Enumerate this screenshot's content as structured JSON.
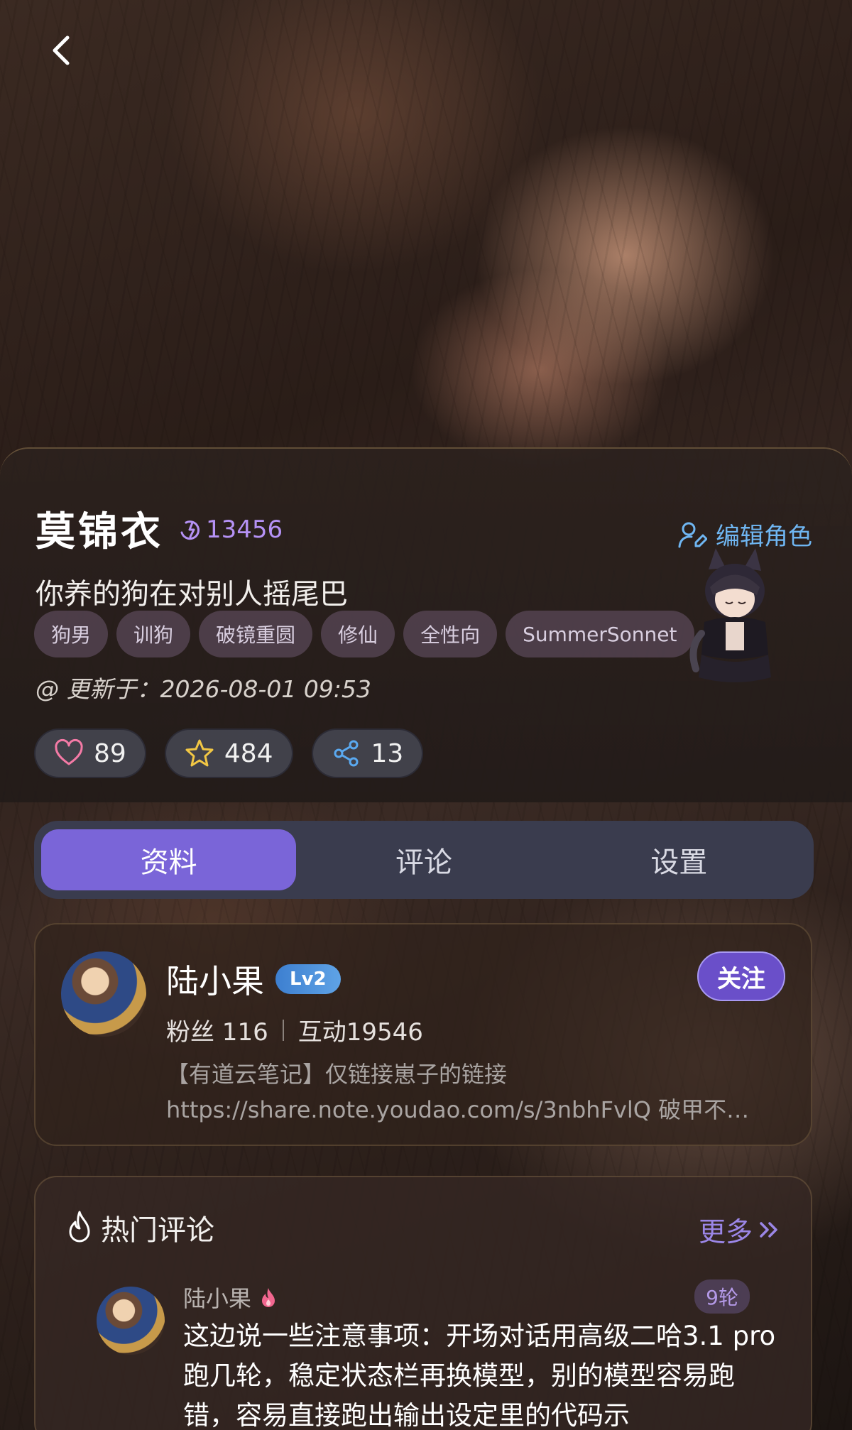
{
  "header": {
    "back_icon": "chevron-left-icon"
  },
  "character": {
    "name": "莫锦衣",
    "heat": "13456",
    "edit_label": "编辑角色",
    "tagline": "你养的狗在对别人摇尾巴",
    "tags": [
      "狗男",
      "训狗",
      "破镜重圆",
      "修仙",
      "全性向",
      "SummerSonnet"
    ],
    "updated": "@ 更新于：2026-08-01 09:53",
    "stats": {
      "likes": "89",
      "favorites": "484",
      "shares": "13"
    }
  },
  "tabs": [
    {
      "label": "资料",
      "active": true
    },
    {
      "label": "评论",
      "active": false
    },
    {
      "label": "设置",
      "active": false
    }
  ],
  "author": {
    "name": "陆小果",
    "level": "Lv2",
    "follow_label": "关注",
    "fans_label": "粉丝 116",
    "interactions_label": "互动19546",
    "bio_line1": "【有道云笔记】仅链接崽子的链接",
    "bio_line2": "https://share.note.youdao.com/s/3nbhFvlQ 破甲不…"
  },
  "hot_comments": {
    "title": "热门评论",
    "more_label": "更多",
    "items": [
      {
        "user": "陆小果",
        "rounds": "9轮",
        "text": "这边说一些注意事项：开场对话用高级二哈3.1 pro跑几轮，稳定状态栏再换模型，别的模型容易跑错，容易直接跑出输出设定里的代码示"
      }
    ]
  },
  "colors": {
    "accent": "#7a65d8",
    "heat": "#b592f5",
    "edit": "#6fb6f2",
    "follow": "#6a4fc9"
  }
}
